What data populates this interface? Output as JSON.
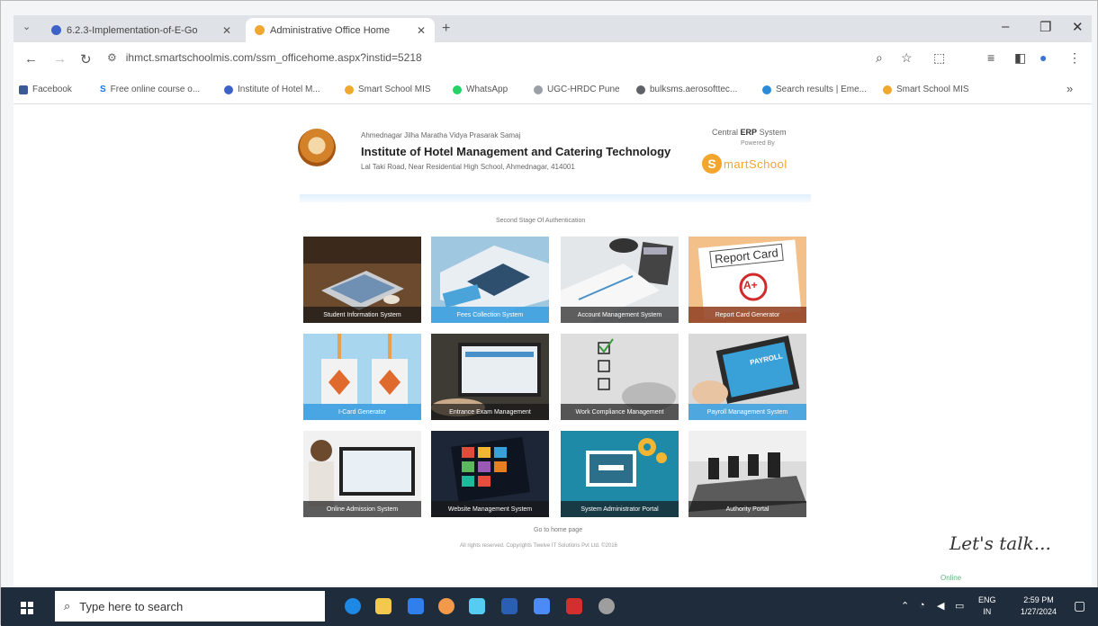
{
  "browser": {
    "tabs": [
      {
        "label": "6.2.3-Implementation-of-E-Go",
        "active": false
      },
      {
        "label": "Administrative Office Home",
        "active": true
      }
    ],
    "new_tab": "+",
    "url": "ihmct.smartschoolmis.com/ssm_officehome.aspx?instid=5218"
  },
  "bookmarks": [
    "Facebook",
    "Free online course o...",
    "Institute of Hotel M...",
    "Smart School MIS",
    "WhatsApp",
    "UGC-HRDC Pune",
    "bulksms.aerosofttec...",
    "Search results | Eme...",
    "Smart School MIS"
  ],
  "bookmarks_more": "»",
  "page": {
    "org_line1": "Ahmednagar Jilha Maratha Vidya Prasarak Samaj",
    "title": "Institute of Hotel Management and Catering Technology",
    "address": "Lal Taki Road, Near Residential High School, Ahmednagar, 414001",
    "erp_prefix": "Central",
    "erp_bold": "ERP",
    "erp_suffix": "System",
    "powered_by": "Powered By",
    "brand_s": "S",
    "brand_mart": "mart",
    "brand_school": "School",
    "stage_text": "Second Stage Of Authentication",
    "modules": [
      "Student Information System",
      "Fees Collection System",
      "Account Management System",
      "Report Card Generator",
      "I-Card Generator",
      "Entrance Exam Management",
      "Work Compliance Management",
      "Payroll Management System",
      "Online Admission System",
      "Website Management System",
      "System Administrator Portal",
      "Authority Portal"
    ],
    "report_card_text": "Report Card",
    "grade_text": "A+",
    "payroll_text": "PAYROLL",
    "goto_home": "Go to home page",
    "copyright": "All rights reserved. Copyrights Twelve IT Solutions Pvt Ltd. ©2016",
    "chat_text": "Let's talk...",
    "chat_status": "Online"
  },
  "taskbar": {
    "search_placeholder": "Type here to search",
    "lang_1": "ENG",
    "lang_2": "IN",
    "time": "2:59 PM",
    "date": "1/27/2024"
  }
}
